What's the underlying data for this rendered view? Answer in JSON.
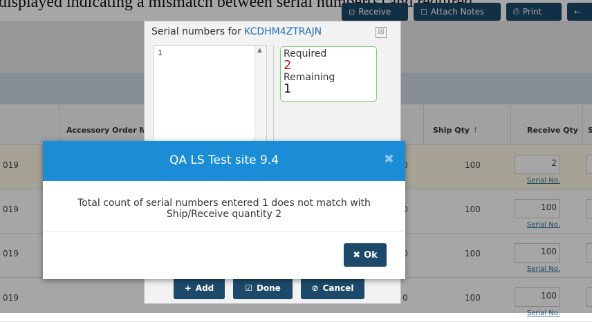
{
  "top_partial_text": "displayed indicating a mismatch between serial number(s) and required",
  "toolbar": {
    "receive_label": "Receive",
    "attach_notes_label": "Attach Notes",
    "print_label": "Print"
  },
  "table": {
    "headers": {
      "accessory_order": "Accessory Order N",
      "ship_qty": "Ship Qty",
      "receive_qty": "Receive Qty",
      "col_s": "S"
    },
    "rows": [
      {
        "date": "019",
        "zero": "0",
        "ship_qty": "100",
        "receive_qty": "2",
        "serial_label": "Serial No."
      },
      {
        "date": "019",
        "zero": "0",
        "ship_qty": "100",
        "receive_qty": "100",
        "serial_label": "Serial No."
      },
      {
        "date": "019",
        "zero": "0",
        "ship_qty": "100",
        "receive_qty": "100",
        "serial_label": "Serial No."
      },
      {
        "date": "019",
        "zero": "0",
        "ship_qty": "100",
        "receive_qty": "100",
        "serial_label": "Serial No."
      }
    ]
  },
  "serial_modal": {
    "title_prefix": "Serial numbers for",
    "item_code": "KCDHM4ZTRAJN",
    "close_glyph": "☒",
    "serial_value": "1",
    "required_label": "Required",
    "required_value": "2",
    "remaining_label": "Remaining",
    "remaining_value": "1",
    "add_label": "Add",
    "done_label": "Done",
    "cancel_label": "Cancel"
  },
  "alert": {
    "title": "QA LS Test site 9.4",
    "close_glyph": "✖",
    "message": "Total count of serial numbers entered 1 does not match with Ship/Receive quantity 2",
    "ok_label": "Ok"
  },
  "colors": {
    "dark_button": "#1d4a6a",
    "alert_header": "#1a8dd6",
    "required_red": "#c0181f",
    "info_border": "#77c777"
  }
}
